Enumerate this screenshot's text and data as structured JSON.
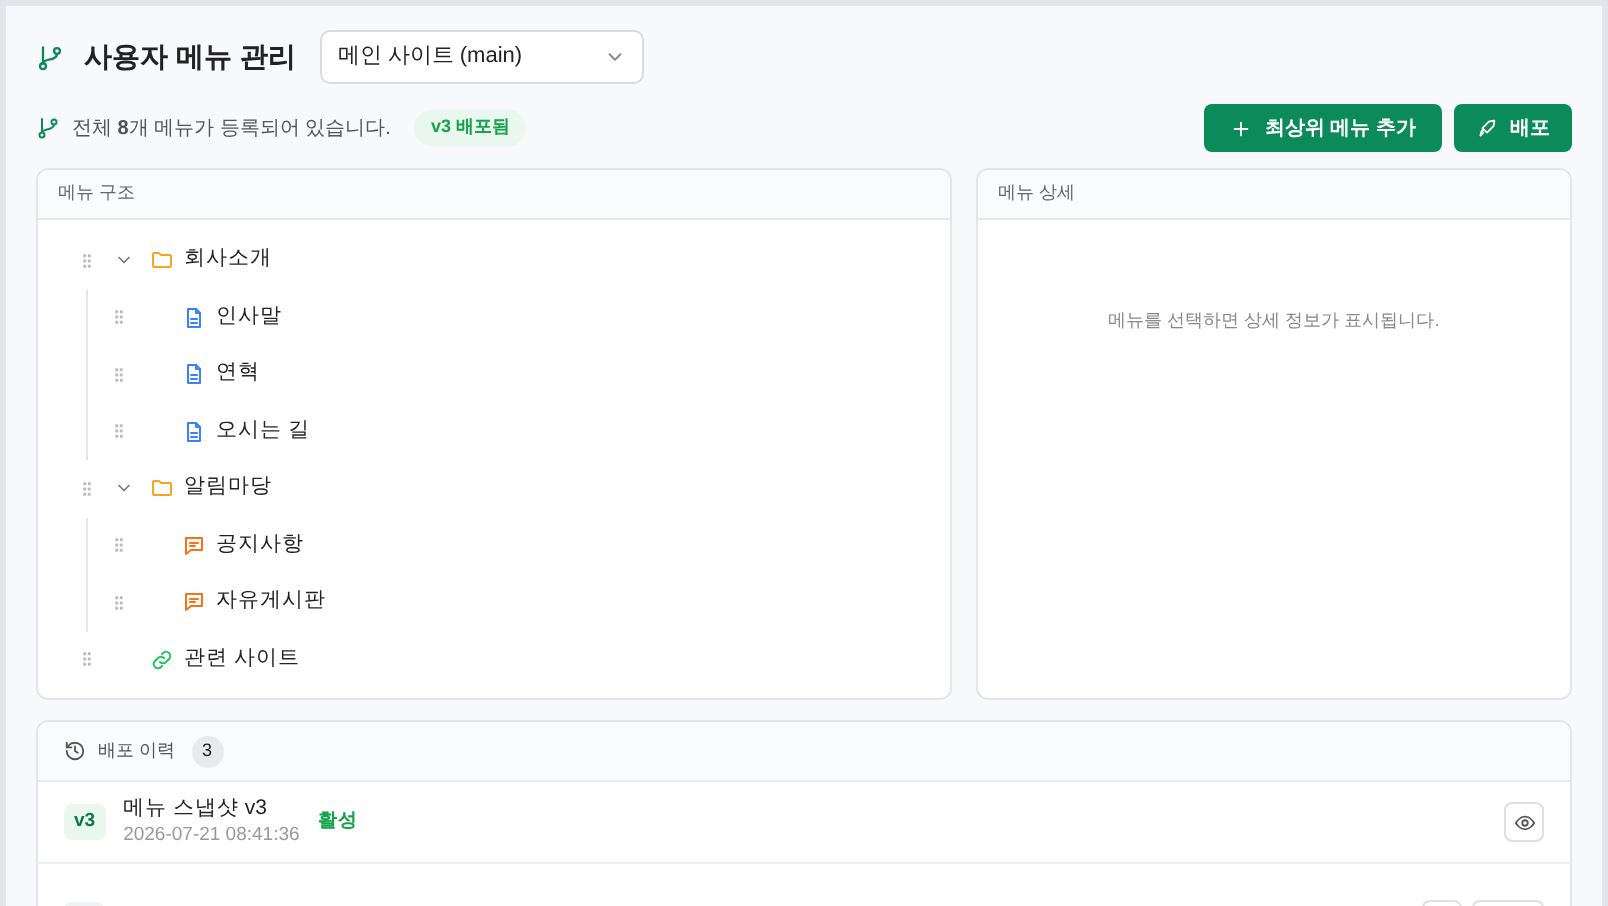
{
  "header": {
    "title": "사용자 메뉴 관리",
    "site_select": "메인 사이트 (main)"
  },
  "summary": {
    "text": "전체 **8**개 메뉴가 등록되어 있습니다.",
    "badge": "v3 배포됨"
  },
  "actions": [
    {
      "kind": "add",
      "label": "최상위 메뉴 추가"
    },
    {
      "kind": "deploy",
      "label": "배포"
    }
  ],
  "tree_panel": {
    "title": "메뉴 구조",
    "items": [
      {
        "kind": "folder",
        "label": "회사소개",
        "expanded": true,
        "children": [
          {
            "kind": "page",
            "label": "인사말"
          },
          {
            "kind": "page",
            "label": "연혁"
          },
          {
            "kind": "page",
            "label": "오시는 길"
          }
        ]
      },
      {
        "kind": "folder",
        "label": "알림마당",
        "expanded": true,
        "children": [
          {
            "kind": "board",
            "label": "공지사항"
          },
          {
            "kind": "board",
            "label": "자유게시판"
          }
        ]
      },
      {
        "kind": "link",
        "label": "관련 사이트"
      }
    ]
  },
  "detail_panel": {
    "title": "메뉴 상세",
    "empty_text": "메뉴를 선택하면 상세 정보가 표시됩니다."
  },
  "history": {
    "title": "배포 이력",
    "count": "3",
    "rows": [
      {
        "version": "v3",
        "title": "메뉴 스냅샷 v3",
        "time": "2026-07-21 08:41:36",
        "status": "활성",
        "active": true
      }
    ]
  }
}
